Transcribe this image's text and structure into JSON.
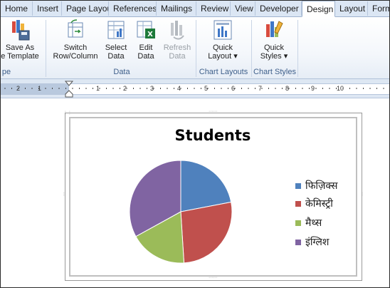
{
  "tabs": [
    {
      "label": "Home"
    },
    {
      "label": "Insert"
    },
    {
      "label": "Page Layout"
    },
    {
      "label": "References"
    },
    {
      "label": "Mailings"
    },
    {
      "label": "Review"
    },
    {
      "label": "View"
    },
    {
      "label": "Developer"
    },
    {
      "label": "Design"
    },
    {
      "label": "Layout"
    },
    {
      "label": "Format"
    }
  ],
  "ribbon": {
    "save_as_template": {
      "line1": "Save As",
      "line2": "e Template"
    },
    "switch": {
      "line1": "Switch",
      "line2": "Row/Column"
    },
    "select_data": {
      "line1": "Select",
      "line2": "Data"
    },
    "edit_data": {
      "line1": "Edit",
      "line2": "Data"
    },
    "refresh_data": {
      "line1": "Refresh",
      "line2": "Data"
    },
    "quick_layout": {
      "line1": "Quick",
      "line2": "Layout ▾"
    },
    "quick_styles": {
      "line1": "Quick",
      "line2": "Styles ▾"
    },
    "groups": {
      "type": "pe",
      "data": "Data",
      "chart_layouts": "Chart Layouts",
      "chart_styles": "Chart Styles"
    }
  },
  "ruler": {
    "numbers": [
      "2",
      "1",
      "1",
      "2",
      "3",
      "4",
      "5",
      "6",
      "7",
      "8",
      "9",
      "10"
    ]
  },
  "chart_data": {
    "type": "pie",
    "title": "Students",
    "categories": [
      "फिज़िक्स",
      "केमिस्ट्री",
      "मैथ्स",
      "इंग्लिश"
    ],
    "values": [
      22,
      27,
      18,
      33
    ],
    "colors": [
      "#4f81bd",
      "#c0504d",
      "#9bbb59",
      "#8064a2"
    ],
    "legend_position": "right"
  }
}
